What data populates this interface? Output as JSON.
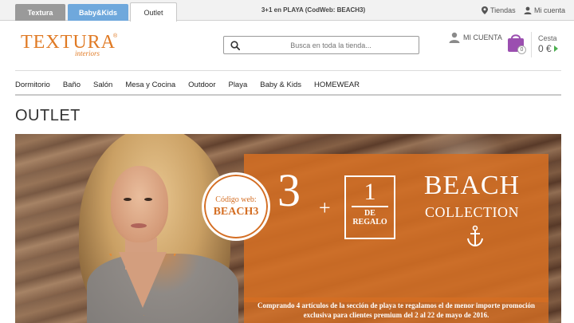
{
  "top_tabs": [
    {
      "label": "Textura"
    },
    {
      "label": "Baby&Kids"
    },
    {
      "label": "Outlet"
    }
  ],
  "promo_bar": "3+1 en PLAYA (CodWeb: BEACH3)",
  "top_links": {
    "tiendas": "Tiendas",
    "mi_cuenta": "Mi cuenta"
  },
  "logo": {
    "name": "TEXTURA",
    "sub": "interiors",
    "registered": "®"
  },
  "search": {
    "placeholder": "Busca en toda la tienda..."
  },
  "account": {
    "label": "MI CUENTA"
  },
  "cart": {
    "count": "0",
    "label": "Cesta",
    "amount": "0 €"
  },
  "nav": [
    {
      "label": "Dormitorio"
    },
    {
      "label": "Baño"
    },
    {
      "label": "Salón"
    },
    {
      "label": "Mesa y Cocina"
    },
    {
      "label": "Outdoor"
    },
    {
      "label": "Playa"
    },
    {
      "label": "Baby & Kids"
    },
    {
      "label": "HOMEWEAR"
    }
  ],
  "page_title": "OUTLET",
  "banner": {
    "code_label": "Código web:",
    "code_value": "BEACH3",
    "big_number": "3",
    "plus": "+",
    "gift_number": "1",
    "gift_de": "DE",
    "gift_regalo": "REGALO",
    "title": "BEACH",
    "subtitle": "COLLECTION",
    "promo_text": "Comprando 4 artículos de la sección de playa te regalamos el de menor importe promoción exclusiva para clientes premium del 2 al 22 de mayo de 2016."
  },
  "colors": {
    "brand_orange": "#e07a24",
    "banner_orange": "#d46e23",
    "tab_grey": "#9a9a9a",
    "tab_blue": "#6fa8dc",
    "cart_purple": "#9b4fb0",
    "arrow_green": "#4caf50"
  },
  "icons": {
    "tiendas": "map-pin-icon",
    "mi_cuenta": "user-icon",
    "search": "search-icon",
    "account": "user-icon",
    "cart": "shopping-bag-icon",
    "banner": "anchor-icon"
  }
}
